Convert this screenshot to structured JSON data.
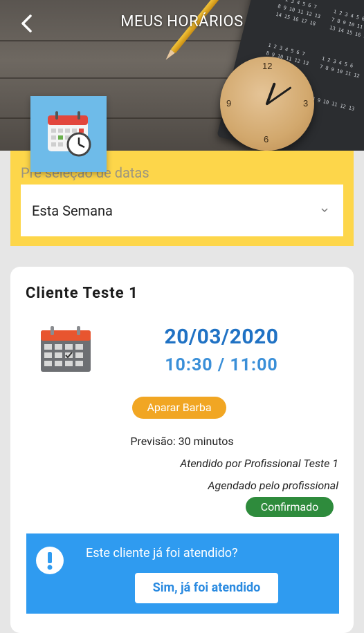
{
  "header": {
    "title": "MEUS HORÁRIOS",
    "back_icon": "chevron-left-icon",
    "clock_numbers": [
      "12",
      "3",
      "6",
      "9"
    ]
  },
  "filter": {
    "label": "Pré seleção de datas",
    "selected": "Esta Semana",
    "icon": "chevron-down-icon"
  },
  "appointment": {
    "client": "Cliente Teste 1",
    "date": "20/03/2020",
    "time": "10:30 / 11:00",
    "service": "Aparar Barba",
    "forecast": "Previsão: 30 minutos",
    "served_by": "Atendido por Profissional Teste 1",
    "scheduled_by": "Agendado pelo profissional",
    "status": "Confirmado"
  },
  "alert": {
    "question": "Este cliente já foi atendido?",
    "button": "Sim, já foi atendido"
  },
  "colors": {
    "accent_yellow": "#fdd64a",
    "date_blue": "#2072c4",
    "service_orange": "#f1a623",
    "status_green": "#2e8b3c",
    "alert_blue": "#2f9bf0"
  }
}
